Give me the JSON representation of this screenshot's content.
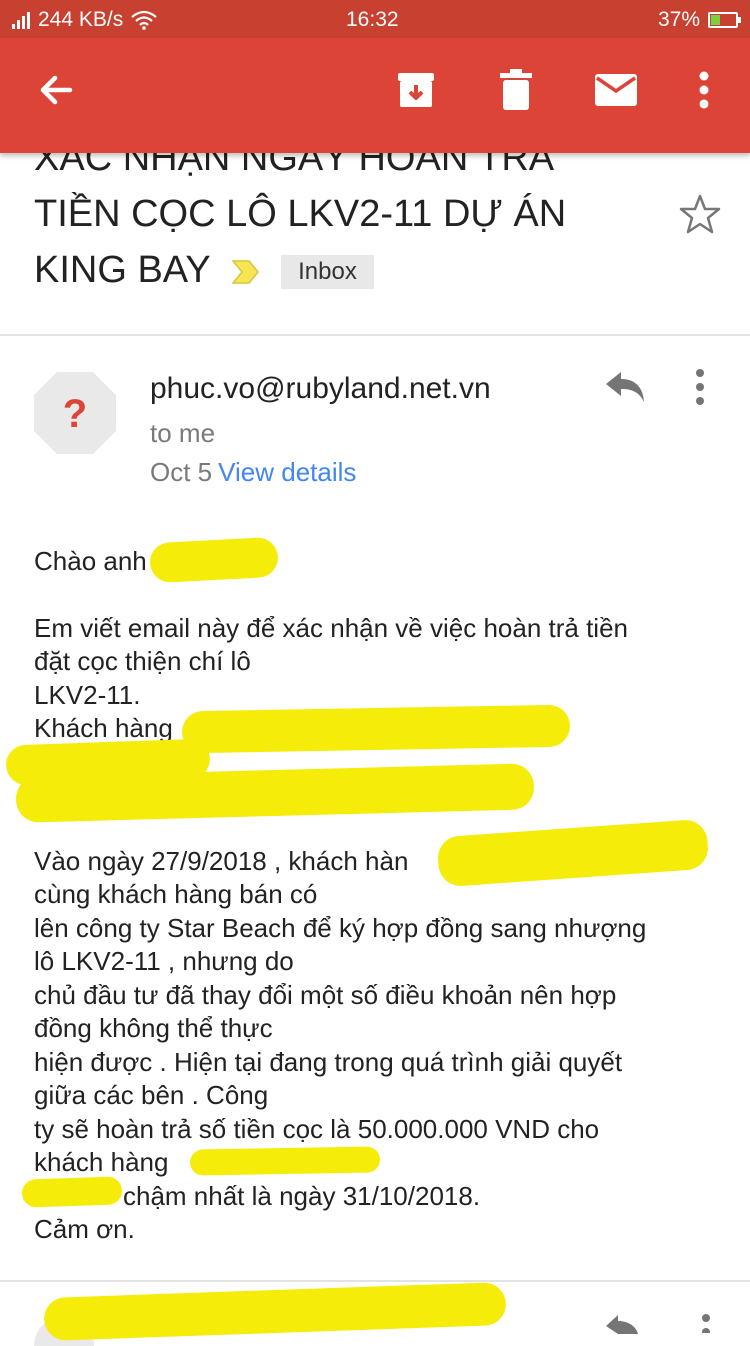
{
  "status_bar": {
    "speed": "244 KB/s",
    "time": "16:32",
    "battery": "37%",
    "battery_level": 0.37
  },
  "app_bar": {
    "icons": [
      "back-arrow-icon",
      "archive-icon",
      "delete-icon",
      "mark-unread-icon",
      "more-vert-icon"
    ]
  },
  "email": {
    "subject_top_cut": "XÁC NHẬN NGÀY HOÀN TRẢ",
    "subject_line2": "TIỀN CỌC LÔ LKV2-11 DỰ ÁN",
    "subject_line3": "KING BAY",
    "label": "Inbox",
    "sender": "phuc.vo@rubyland.net.vn",
    "recipient": "to me",
    "date": "Oct 5",
    "details_link": "View details",
    "body": {
      "greeting": "Chào anh",
      "l1": "Em viết email này để xác nhận về việc hoàn trả tiền",
      "l2": "đặt cọc thiện chí lô",
      "l3": "LKV2-11.",
      "l4": "Khách hàng",
      "l5": "Vào ngày 27/9/2018 , khách hàn",
      "l6": "cùng khách hàng bán có",
      "l7": "lên công ty Star Beach để ký hợp đồng sang nhượng",
      "l8": "lô LKV2-11 , nhưng do",
      "l9": "chủ đầu tư đã thay đổi một số điều khoản nên hợp",
      "l10": "đồng không thể thực",
      "l11": "hiện được . Hiện tại đang trong quá trình giải quyết",
      "l12": "giữa các bên . Công",
      "l13": "ty sẽ hoàn trả số tiền cọc là 50.000.000 VND cho",
      "l14": "khách hàng",
      "l15": "chậm nhất là ngày 31/10/2018.",
      "l16": "Cảm ơn."
    }
  },
  "colors": {
    "status_bar": "#c8402f",
    "app_bar": "#db4437",
    "link": "#4285f4",
    "redaction": "#f6ec0a"
  }
}
